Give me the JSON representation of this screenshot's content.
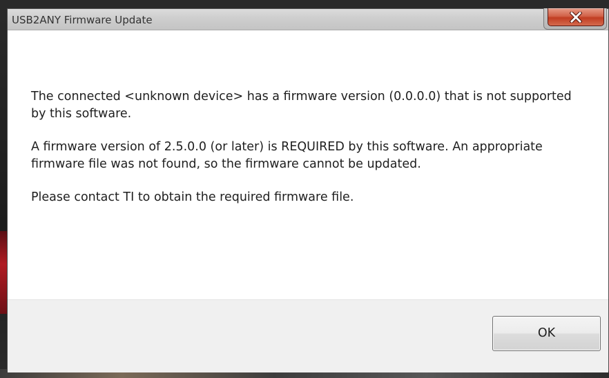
{
  "window": {
    "title": "USB2ANY Firmware Update"
  },
  "title_bar": {
    "close_icon": "close-icon",
    "close_color": "#c13d22"
  },
  "message": {
    "paragraphs": [
      "The connected <unknown device> has a firmware version (0.0.0.0) that is not supported by this software.",
      "A firmware version of 2.5.0.0 (or later) is REQUIRED by this software. An appropriate firmware file was not found, so the firmware cannot be updated.",
      "Please contact TI to obtain the required firmware file."
    ]
  },
  "buttons": {
    "ok_label": "OK"
  }
}
